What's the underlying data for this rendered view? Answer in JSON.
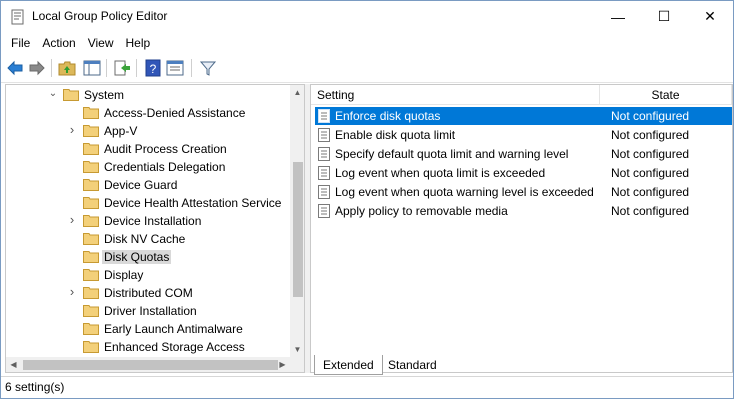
{
  "window": {
    "title": "Local Group Policy Editor",
    "controls": {
      "minimize": "—",
      "maximize": "☐",
      "close": "✕"
    }
  },
  "menu": [
    "File",
    "Action",
    "View",
    "Help"
  ],
  "toolbar": {
    "buttons": [
      "back-icon",
      "forward-icon",
      "up-folder-icon",
      "show-hide-tree-icon",
      "export-list-icon",
      "help-icon",
      "properties-icon",
      "filter-icon"
    ]
  },
  "tree": {
    "parent": "System",
    "items": [
      {
        "label": "Access-Denied Assistance",
        "expandable": false,
        "selected": false
      },
      {
        "label": "App-V",
        "expandable": true,
        "selected": false
      },
      {
        "label": "Audit Process Creation",
        "expandable": false,
        "selected": false
      },
      {
        "label": "Credentials Delegation",
        "expandable": false,
        "selected": false
      },
      {
        "label": "Device Guard",
        "expandable": false,
        "selected": false
      },
      {
        "label": "Device Health Attestation Service",
        "expandable": false,
        "selected": false
      },
      {
        "label": "Device Installation",
        "expandable": true,
        "selected": false
      },
      {
        "label": "Disk NV Cache",
        "expandable": false,
        "selected": false
      },
      {
        "label": "Disk Quotas",
        "expandable": false,
        "selected": true
      },
      {
        "label": "Display",
        "expandable": false,
        "selected": false
      },
      {
        "label": "Distributed COM",
        "expandable": true,
        "selected": false
      },
      {
        "label": "Driver Installation",
        "expandable": false,
        "selected": false
      },
      {
        "label": "Early Launch Antimalware",
        "expandable": false,
        "selected": false
      },
      {
        "label": "Enhanced Storage Access",
        "expandable": false,
        "selected": false
      }
    ]
  },
  "list": {
    "columns": {
      "setting": "Setting",
      "state": "State"
    },
    "rows": [
      {
        "name": "Enforce disk quotas",
        "state": "Not configured",
        "selected": true
      },
      {
        "name": "Enable disk quota limit",
        "state": "Not configured",
        "selected": false
      },
      {
        "name": "Specify default quota limit and warning level",
        "state": "Not configured",
        "selected": false
      },
      {
        "name": "Log event when quota limit is exceeded",
        "state": "Not configured",
        "selected": false
      },
      {
        "name": "Log event when quota warning level is exceeded",
        "state": "Not configured",
        "selected": false
      },
      {
        "name": "Apply policy to removable media",
        "state": "Not configured",
        "selected": false
      }
    ]
  },
  "tabs": {
    "extended": "Extended",
    "standard": "Standard"
  },
  "status": {
    "text": "6 setting(s)"
  },
  "colors": {
    "selection": "#0078d7",
    "folder": "#dcb85a",
    "tree_selection": "#d9d9d9"
  }
}
